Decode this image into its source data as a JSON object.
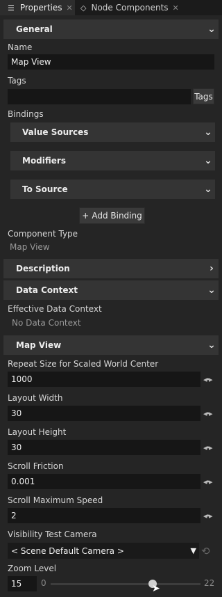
{
  "tabs": [
    {
      "label": "Properties",
      "active": true,
      "icon": "list-icon"
    },
    {
      "label": "Node Components",
      "active": false,
      "icon": "node-components-icon"
    }
  ],
  "general": {
    "header": "General",
    "name_label": "Name",
    "name_value": "Map View",
    "tags_label": "Tags",
    "tags_value": "",
    "tags_button": "Tags",
    "bindings_label": "Bindings",
    "binding_sections": [
      "Value Sources",
      "Modifiers",
      "To Source"
    ],
    "add_binding": "Add Binding",
    "component_type_label": "Component Type",
    "component_type_value": "Map View"
  },
  "description": {
    "header": "Description"
  },
  "data_context": {
    "header": "Data Context",
    "effective_label": "Effective Data Context",
    "effective_value": "No Data Context"
  },
  "map_view": {
    "header": "Map View",
    "properties": [
      {
        "label": "Repeat Size for Scaled World Center",
        "value": "1000"
      },
      {
        "label": "Layout Width",
        "value": "30"
      },
      {
        "label": "Layout Height",
        "value": "30"
      },
      {
        "label": "Scroll Friction",
        "value": "0.001"
      },
      {
        "label": "Scroll Maximum Speed",
        "value": "2"
      }
    ],
    "visibility_label": "Visibility Test Camera",
    "visibility_value": "< Scene Default Camera >",
    "zoom_label": "Zoom Level",
    "zoom_value": "15",
    "zoom_min": "0",
    "zoom_max": "22",
    "zoom_fraction": 0.68
  }
}
